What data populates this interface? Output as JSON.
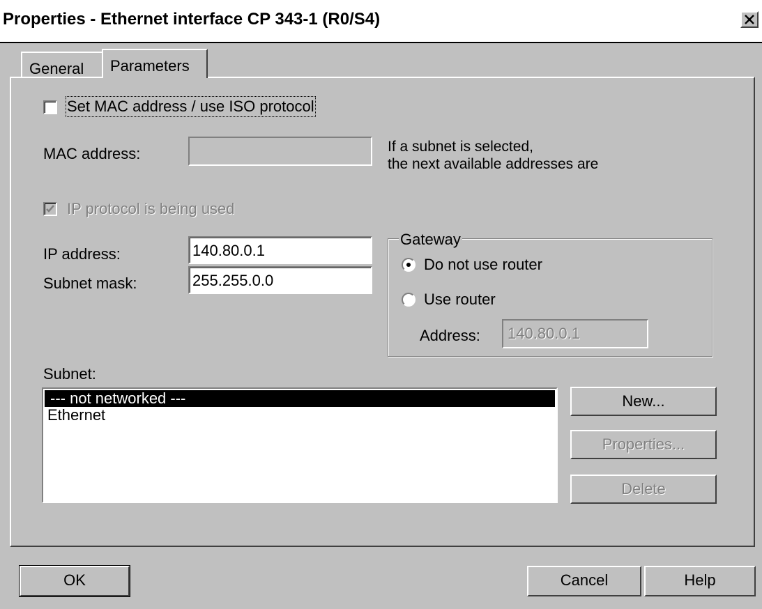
{
  "window": {
    "title": "Properties - Ethernet interface  CP 343-1 (R0/S4)",
    "close_glyph": "×"
  },
  "tabs": [
    {
      "label": "General",
      "active": false
    },
    {
      "label": "Parameters",
      "active": true
    }
  ],
  "iso": {
    "checkbox_label": "Set MAC address / use ISO protocol",
    "checked": false
  },
  "mac": {
    "label": "MAC address:",
    "value": "",
    "hint_line1": "If a subnet is selected,",
    "hint_line2": "the next available addresses are"
  },
  "ip_protocol": {
    "label": "IP protocol is being used",
    "checked": true,
    "enabled": false
  },
  "ip": {
    "address_label": "IP address:",
    "address_value": "140.80.0.1",
    "mask_label": "Subnet mask:",
    "mask_value": "255.255.0.0"
  },
  "gateway": {
    "legend": "Gateway",
    "option_no_router": "Do not use router",
    "option_use_router": "Use router",
    "selected": "no_router",
    "address_label": "Address:",
    "address_value": "140.80.0.1"
  },
  "subnet": {
    "label": "Subnet:",
    "items": [
      "--- not networked ---",
      "Ethernet"
    ],
    "selected_index": 0
  },
  "subnet_buttons": {
    "new": "New...",
    "properties": "Properties...",
    "delete": "Delete"
  },
  "footer": {
    "ok": "OK",
    "cancel": "Cancel",
    "help": "Help"
  }
}
